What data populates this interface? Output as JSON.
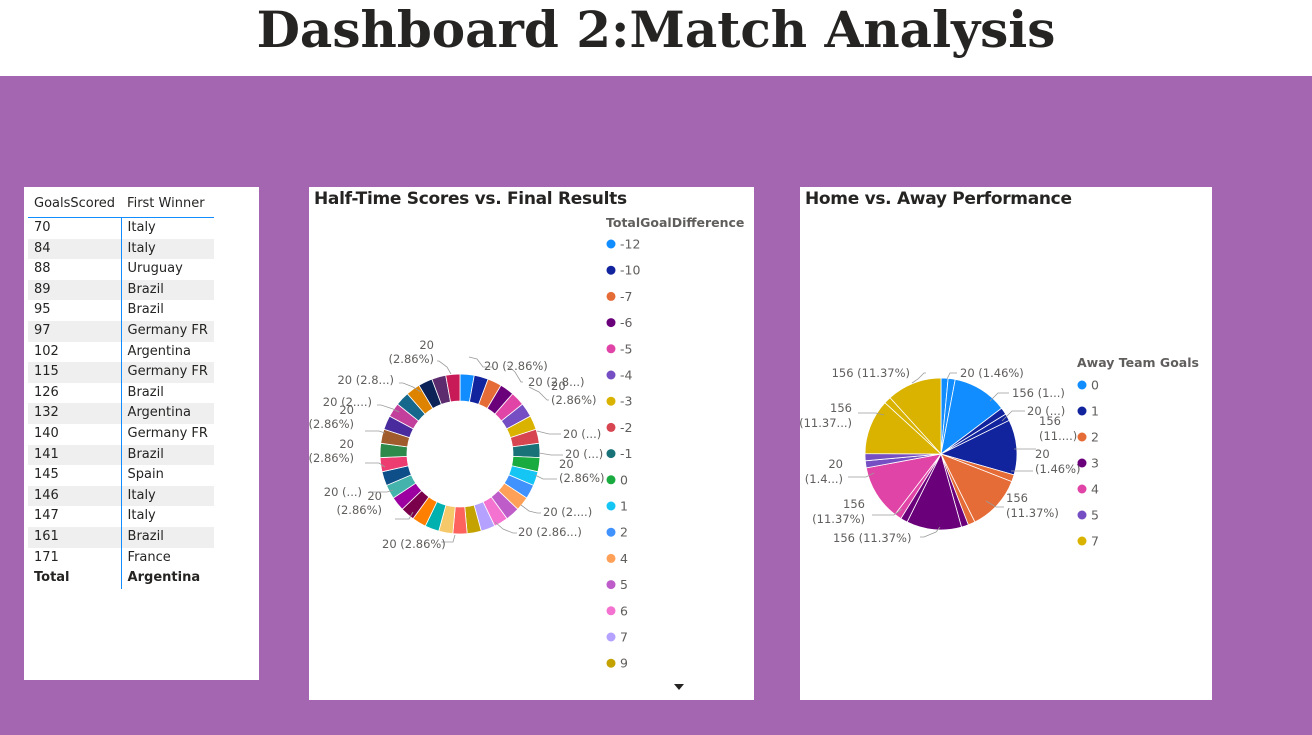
{
  "page": {
    "title": "Dashboard 2:Match Analysis"
  },
  "table": {
    "headers": [
      "GoalsScored",
      "First Winner"
    ],
    "rows": [
      [
        "70",
        "Italy"
      ],
      [
        "84",
        "Italy"
      ],
      [
        "88",
        "Uruguay"
      ],
      [
        "89",
        "Brazil"
      ],
      [
        "95",
        "Brazil"
      ],
      [
        "97",
        "Germany FR"
      ],
      [
        "102",
        "Argentina"
      ],
      [
        "115",
        "Germany FR"
      ],
      [
        "126",
        "Brazil"
      ],
      [
        "132",
        "Argentina"
      ],
      [
        "140",
        "Germany FR"
      ],
      [
        "141",
        "Brazil"
      ],
      [
        "145",
        "Spain"
      ],
      [
        "146",
        "Italy"
      ],
      [
        "147",
        "Italy"
      ],
      [
        "161",
        "Brazil"
      ],
      [
        "171",
        "France"
      ]
    ],
    "total": [
      "Total",
      "Argentina"
    ]
  },
  "chart_data": [
    {
      "type": "pie",
      "variant": "donut",
      "title": "Half-Time Scores vs. Final Results",
      "legend_title": "TotalGoalDifference",
      "legend_placement": "right",
      "categories": [
        "-12",
        "-10",
        "-7",
        "-6",
        "-5",
        "-4",
        "-3",
        "-2",
        "-1",
        "0",
        "1",
        "2",
        "4",
        "5",
        "6",
        "7",
        "9"
      ],
      "values": [
        20,
        20,
        20,
        20,
        20,
        20,
        20,
        20,
        20,
        20,
        20,
        20,
        20,
        20,
        20,
        20,
        20,
        20,
        20,
        20,
        20,
        20,
        20,
        20,
        20,
        20,
        20,
        20,
        20,
        20,
        20,
        20,
        20,
        20,
        20
      ],
      "colors": [
        "#118dff",
        "#12239e",
        "#e66c37",
        "#6b007b",
        "#e044a7",
        "#744ec2",
        "#d9b300",
        "#d64550",
        "#197278",
        "#1aab40",
        "#15c6f4",
        "#4092ff",
        "#ffa058",
        "#be5dc9",
        "#f472d0",
        "#b5a1ff",
        "#c4a200",
        "#fd625e",
        "#f5c869",
        "#00b1af",
        "#ff8000",
        "#7a004c",
        "#9c00a1",
        "#44b3ab",
        "#0e4f8a",
        "#ed3d70",
        "#2d8a4b",
        "#a05c2c",
        "#4a2b9d",
        "#c23f9c",
        "#15678c",
        "#de8300",
        "#0b2357",
        "#5c2c6f",
        "#c81a57"
      ],
      "data_labels": [
        "20 (2.86%)",
        "20 (2.8...)",
        "20 (2.86%)",
        "20 (...)",
        "20 (...)",
        "20 (2.86%)",
        "20 (2....)",
        "20 (2.86...)",
        "20 (2.86%)",
        "20 (2.86%)",
        "20 (...)",
        "20 (2.86%)",
        "20 (2.86%)",
        "20 (2....)",
        "20 (2.8...)",
        "20 (2.86%)"
      ]
    },
    {
      "type": "pie",
      "title": "Home vs. Away Performance",
      "legend_title": "Away Team Goals",
      "legend_placement": "right",
      "categories": [
        "0",
        "1",
        "2",
        "3",
        "4",
        "5",
        "7"
      ],
      "values": [
        20,
        20,
        156,
        20,
        20,
        156,
        20,
        156,
        20,
        20,
        156,
        20,
        20,
        156,
        20,
        20,
        156,
        20,
        156
      ],
      "colors": [
        "#118dff",
        "#118dff",
        "#118dff",
        "#12239e",
        "#12239e",
        "#12239e",
        "#e66c37",
        "#e66c37",
        "#e66c37",
        "#6b007b",
        "#6b007b",
        "#6b007b",
        "#e044a7",
        "#e044a7",
        "#744ec2",
        "#744ec2",
        "#d9b300",
        "#d9b300",
        "#d9b300"
      ],
      "data_labels": [
        "20 (1.46%)",
        "156 (1...)",
        "20 (...)",
        "156 (11....)",
        "20 (1.46%)",
        "156 (11.37%)",
        "156 (11.37%)",
        "156 (11.37%)",
        "20 (1.4...)",
        "156 (11.37...)",
        "156 (11.37%)"
      ]
    }
  ],
  "legend_colors": {
    "donut": [
      "#118dff",
      "#12239e",
      "#e66c37",
      "#6b007b",
      "#e044a7",
      "#744ec2",
      "#d9b300",
      "#d64550",
      "#197278",
      "#1aab40",
      "#15c6f4",
      "#4092ff",
      "#ffa058",
      "#be5dc9",
      "#f472d0",
      "#b5a1ff",
      "#c4a200"
    ],
    "pie": [
      "#118dff",
      "#12239e",
      "#e66c37",
      "#6b007b",
      "#e044a7",
      "#744ec2",
      "#d9b300"
    ]
  },
  "icons": {
    "legend_more": "triangle-down-icon"
  }
}
